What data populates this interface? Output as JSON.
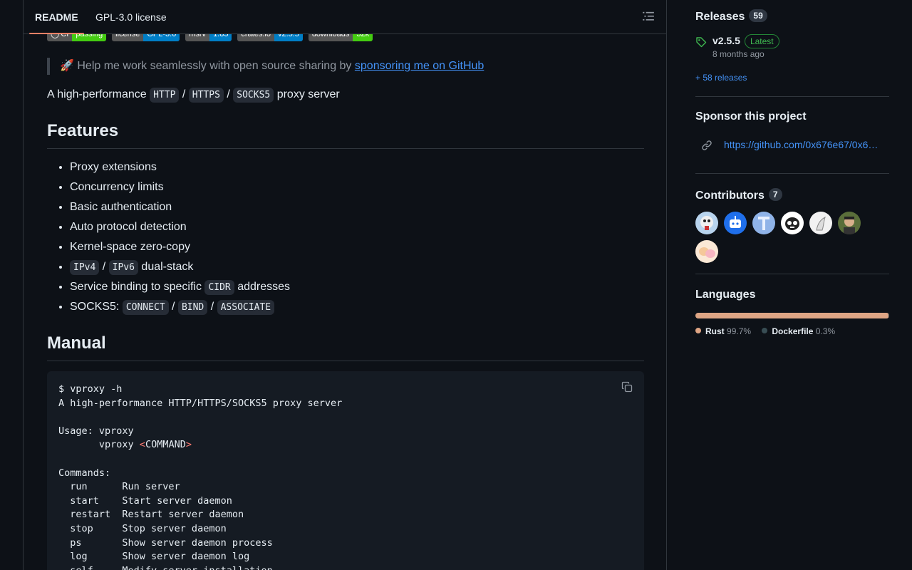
{
  "tabs": {
    "readme": "README",
    "license": "GPL-3.0 license"
  },
  "badges": [
    {
      "left": "CI",
      "right": "passing",
      "color": "#4c1"
    },
    {
      "left": "license",
      "right": "GPL-3.0",
      "color": "#007ec6"
    },
    {
      "left": "msrv",
      "right": "1.85",
      "color": "#007ec6"
    },
    {
      "left": "crates.io",
      "right": "v2.5.5",
      "color": "#007ec6"
    },
    {
      "left": "downloads",
      "right": "32k",
      "color": "#4c1"
    }
  ],
  "quote": {
    "emoji": "🚀",
    "text": "Help me work seamlessly with open source sharing by",
    "link": "sponsoring me on GitHub"
  },
  "intro": {
    "prefix": "A high-performance",
    "c1": "HTTP",
    "c2": "HTTPS",
    "c3": "SOCKS5",
    "sep": "/",
    "suffix": "proxy server"
  },
  "features": {
    "heading": "Features",
    "items": {
      "proxy_ext": "Proxy extensions",
      "concurrency": "Concurrency limits",
      "auth": "Basic authentication",
      "auto": "Auto protocol detection",
      "zerocopy": "Kernel-space zero-copy",
      "ipv4": "IPv4",
      "ipv6": "IPv6",
      "dualstack": "dual-stack",
      "binding": "Service binding to specific",
      "cidr": "CIDR",
      "addresses": "addresses",
      "socks5": "SOCKS5:",
      "connect": "CONNECT",
      "bind": "BIND",
      "associate": "ASSOCIATE"
    }
  },
  "manual": {
    "heading": "Manual",
    "code": {
      "line1": "$ vproxy -h",
      "line2": "A high-performance HTTP/HTTPS/SOCKS5 proxy server",
      "usage1": "Usage: vproxy",
      "usage2_prefix": "       vproxy ",
      "lt": "<",
      "cmd": "COMMAND",
      "gt": ">",
      "commands_label": "Commands:",
      "commands": [
        {
          "name": "run",
          "desc": "Run server"
        },
        {
          "name": "start",
          "desc": "Start server daemon"
        },
        {
          "name": "restart",
          "desc": "Restart server daemon"
        },
        {
          "name": "stop",
          "desc": "Stop server daemon"
        },
        {
          "name": "ps",
          "desc": "Show server daemon process"
        },
        {
          "name": "log",
          "desc": "Show server daemon log"
        },
        {
          "name": "self",
          "desc": "Modify server installation"
        }
      ]
    }
  },
  "sidebar": {
    "releases": {
      "title": "Releases",
      "count": "59",
      "version": "v2.5.5",
      "latest": "Latest",
      "time": "8 months ago",
      "more": "+ 58 releases"
    },
    "sponsor": {
      "title": "Sponsor this project",
      "url": "https://github.com/0x676e67/0x6…"
    },
    "contributors": {
      "title": "Contributors",
      "count": "7"
    },
    "languages": {
      "title": "Languages",
      "items": [
        {
          "name": "Rust",
          "percent": "99.7%",
          "value": 99.7,
          "color": "#dea584"
        },
        {
          "name": "Dockerfile",
          "percent": "0.3%",
          "value": 0.3,
          "color": "#384d54"
        }
      ]
    }
  }
}
